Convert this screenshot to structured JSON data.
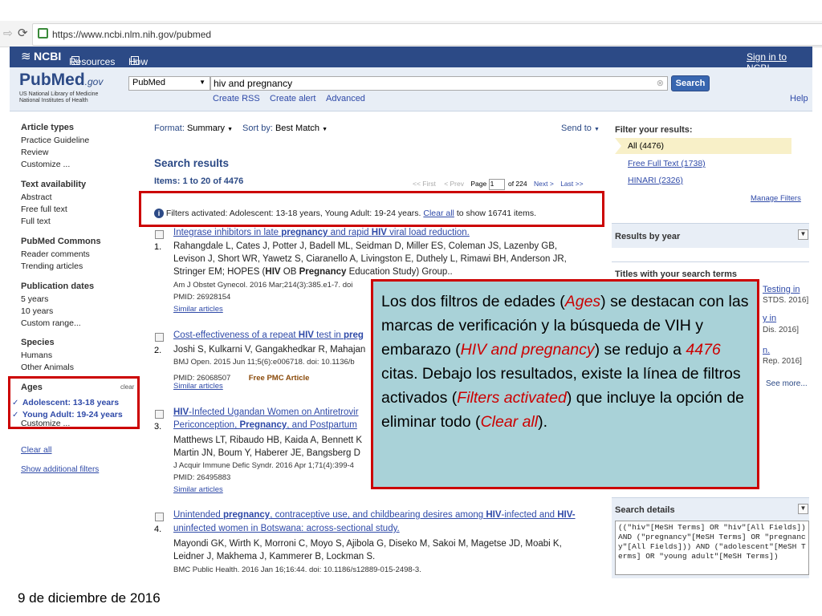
{
  "browser": {
    "url": "https://www.ncbi.nlm.nih.gov/pubmed"
  },
  "ncbi_bar": {
    "brand": "NCBI",
    "resources": "Resources",
    "howto": "How To",
    "signin": "Sign in to NCBI"
  },
  "header": {
    "logo_pub": "Pub",
    "logo_med": "Med",
    "logo_gov": ".gov",
    "org_line1": "US National Library of Medicine",
    "org_line2": "National Institutes of Health",
    "db_select": "PubMed",
    "search_value": "hiv and pregnancy",
    "search_button": "Search",
    "create_rss": "Create RSS",
    "create_alert": "Create alert",
    "advanced": "Advanced",
    "help": "Help"
  },
  "sidebar": {
    "article_types": {
      "title": "Article types",
      "items": [
        "Practice Guideline",
        "Review",
        "Customize ..."
      ]
    },
    "text_availability": {
      "title": "Text availability",
      "items": [
        "Abstract",
        "Free full text",
        "Full text"
      ]
    },
    "pubmed_commons": {
      "title": "PubMed Commons",
      "items": [
        "Reader comments",
        "Trending articles"
      ]
    },
    "publication_dates": {
      "title": "Publication dates",
      "items": [
        "5 years",
        "10 years",
        "Custom range..."
      ]
    },
    "species": {
      "title": "Species",
      "items": [
        "Humans",
        "Other Animals"
      ]
    },
    "ages": {
      "title": "Ages",
      "clear": "clear",
      "items": [
        "Adolescent: 13-18 years",
        "Young Adult: 19-24 years",
        "Customize ..."
      ],
      "check": "✓"
    },
    "clear_all": "Clear all",
    "show_filters": "Show additional filters"
  },
  "toolbar": {
    "format_label": "Format:",
    "format_value": "Summary",
    "sort_label": "Sort by:",
    "sort_value": "Best Match",
    "send_to": "Send to"
  },
  "results": {
    "heading": "Search results",
    "items_label": "Items: 1 to 20 of 4476",
    "pager": {
      "first": "<< First",
      "prev": "< Prev",
      "page_label": "Page",
      "page_value": "1",
      "of": "of 224",
      "next": "Next >",
      "last": "Last >>"
    },
    "filters_notice": {
      "icon": "i",
      "text": "Filters activated: Adolescent: 13-18 years, Young Adult: 19-24 years.",
      "clear_all": "Clear all",
      "suffix": "to show 16741 items."
    },
    "list": [
      {
        "num": "1.",
        "title_a": "Integrase inhibitors in late ",
        "title_b": "pregnancy",
        "title_c": " and rapid ",
        "title_d": "HIV",
        "title_e": " viral load reduction.",
        "authors_1": "Rahangdale L, Cates J, Potter J, Badell ML, Seidman D, Miller ES, Coleman JS, Lazenby GB,",
        "authors_2": "Levison J, Short WR, Yawetz S, Ciaranello A, Livingston E, Duthely L, Rimawi BH, Anderson JR,",
        "authors_3a": "Stringer EM; HOPES (",
        "authors_3b": "HIV",
        "authors_3c": " OB ",
        "authors_3d": "Pregnancy",
        "authors_3e": " Education Study) Group..",
        "journal": "Am J Obstet Gynecol. 2016 Mar;214(3):385.e1-7. doi",
        "pmid": "PMID: 26928154",
        "similar": "Similar articles"
      },
      {
        "num": "2.",
        "title_a": "Cost-effectiveness of a repeat ",
        "title_b": "HIV",
        "title_c": " test in ",
        "title_d": "preg",
        "authors_1": "Joshi S, Kulkarni V, Gangakhedkar R, Mahajan",
        "journal": "BMJ Open. 2015 Jun 11;5(6):e006718. doi: 10.1136/b",
        "pmid": "PMID: 26068507",
        "free_pmc": "Free PMC Article",
        "similar": "Similar articles"
      },
      {
        "num": "3.",
        "title_a": "HIV",
        "title_b": "-Infected Ugandan Women on Antiretrovir",
        "title2_a": "Periconception, ",
        "title2_b": "Pregnancy",
        "title2_c": ", and Postpartum",
        "authors_1": "Matthews LT, Ribaudo HB, Kaida A, Bennett K",
        "authors_2": "Martin JN, Boum Y, Haberer JE, Bangsberg D",
        "journal": "J Acquir Immune Defic Syndr. 2016 Apr 1;71(4):399-4",
        "pmid": "PMID: 26495883",
        "similar": "Similar articles"
      },
      {
        "num": "4.",
        "title_a": "Unintended ",
        "title_b": "pregnancy",
        "title_c": ", contraceptive use, and childbearing desires among ",
        "title_d": "HIV",
        "title_e": "-infected and ",
        "title_f": "HIV-",
        "title2": "uninfected women in Botswana: across-sectional study.",
        "authors_1": "Mayondi GK, Wirth K, Morroni C, Moyo S, Ajibola G, Diseko M, Sakoi M, Magetse JD, Moabi K,",
        "authors_2": "Leidner J, Makhema J, Kammerer B, Lockman S.",
        "journal": "BMC Public Health. 2016 Jan 16;16:44. doi: 10.1186/s12889-015-2498-3."
      }
    ]
  },
  "right_panel": {
    "filter_title": "Filter your results:",
    "filter_all": "All (4476)",
    "filter_free": "Free Full Text (1738)",
    "filter_hinari": "HINARI (2326)",
    "manage_filters": "Manage Filters",
    "results_by_year": "Results by year",
    "titles_with_terms": "Titles with your search terms",
    "frag1a": "Testing in",
    "frag1b": "STDS. 2016]",
    "frag2a": "y in",
    "frag2b": "Dis. 2016]",
    "frag3a": "n.",
    "frag3b": "Rep. 2016]",
    "see_more": "See more...",
    "search_details": "Search details",
    "details_text": "((\"hiv\"[MeSH Terms] OR \"hiv\"[All Fields]) AND (\"pregnancy\"[MeSH Terms] OR \"pregnancy\"[All Fields])) AND (\"adolescent\"[MeSH Terms] OR \"young adult\"[MeSH Terms])"
  },
  "callout": {
    "p1": "Los dos filtros de edades (",
    "p1_em": "Ages",
    "p2": ") se destacan con las marcas de verificación y la búsqueda de VIH y embarazo (",
    "p2_em": "HIV and pregnancy",
    "p3": ") se redujo a ",
    "p3_num": "4476",
    "p4": " citas. Debajo los resultados, existe la línea de filtros activados (",
    "p4_em": "Filters activated",
    "p5": ") que incluye la opción de eliminar todo (",
    "p5_em": "Clear all",
    "p6": ").",
    "accent_color": "#cc0000",
    "bg_color": "#a9d2d8"
  },
  "footer": {
    "date": "9 de diciembre de 2016"
  }
}
